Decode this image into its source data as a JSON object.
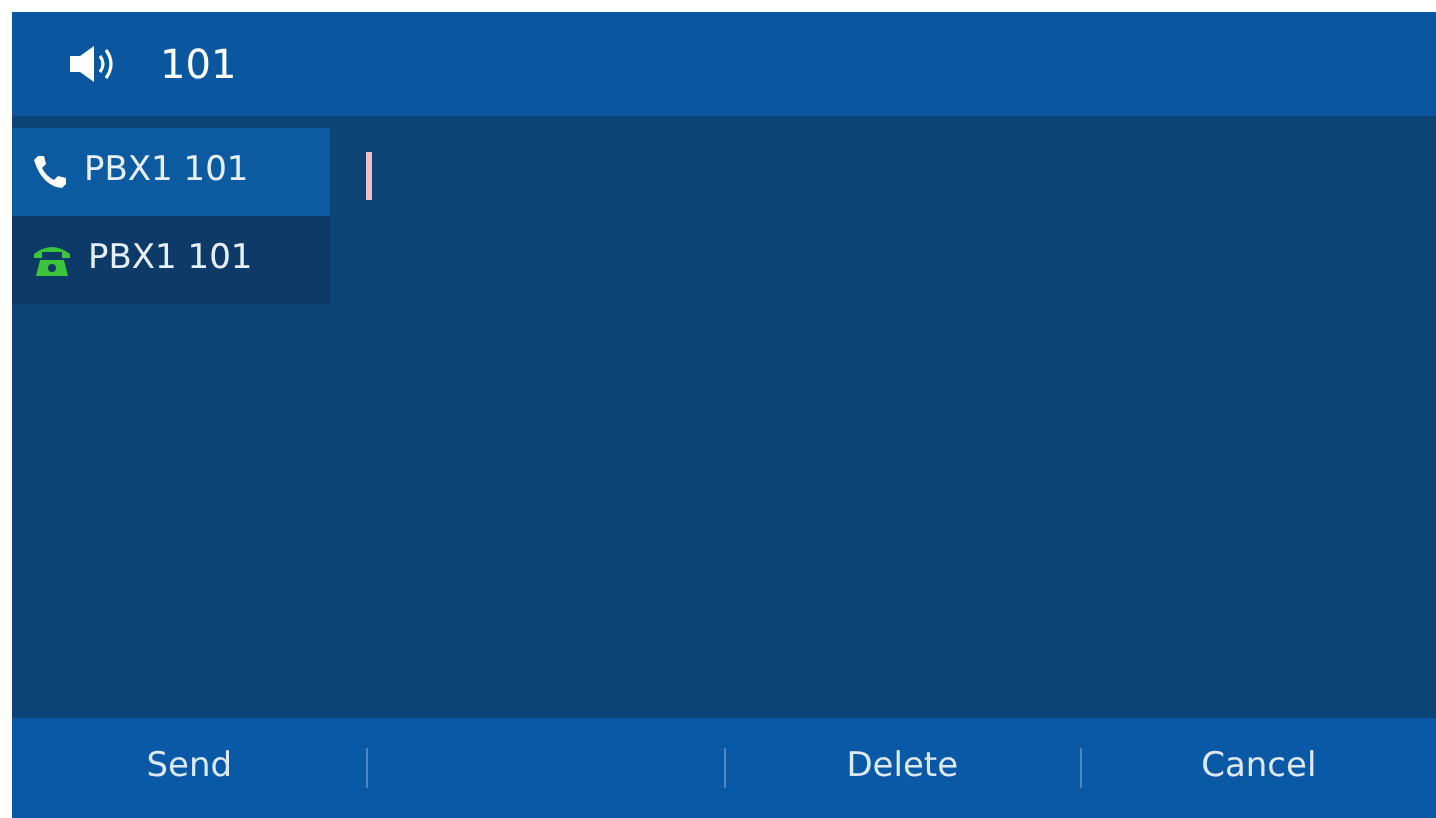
{
  "header": {
    "number": "101"
  },
  "lines": [
    {
      "label": "PBX1 101",
      "kind": "handset",
      "selected": true
    },
    {
      "label": "PBX1 101",
      "kind": "deskphone",
      "selected": false
    }
  ],
  "softkeys": [
    {
      "kind": "key",
      "label": "Send"
    },
    {
      "kind": "empty"
    },
    {
      "kind": "key",
      "label": "Delete"
    },
    {
      "kind": "key",
      "label": "Cancel"
    }
  ]
}
